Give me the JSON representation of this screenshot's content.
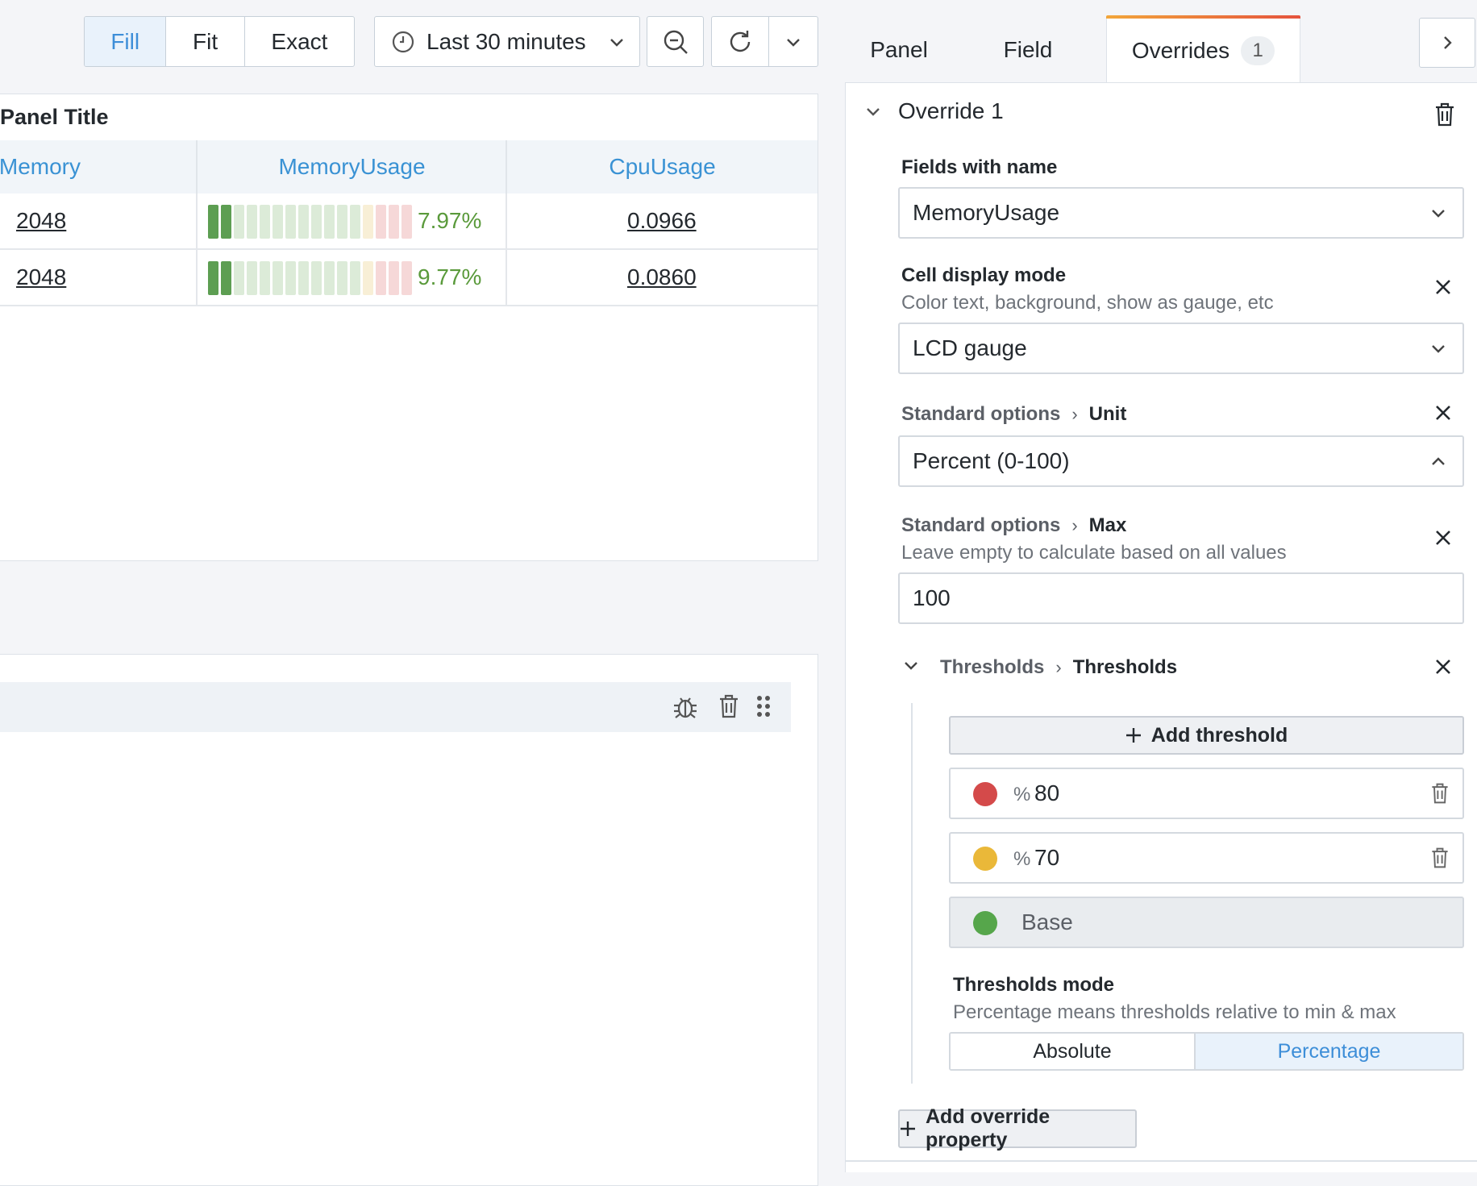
{
  "toolbar": {
    "size_modes": [
      "Fill",
      "Fit",
      "Exact"
    ],
    "active_size_mode": "Fill",
    "time_range": "Last 30 minutes"
  },
  "panel": {
    "title": "Panel Title",
    "columns": [
      "Memory",
      "MemoryUsage",
      "CpuUsage"
    ],
    "rows": [
      {
        "memory": "2048",
        "memory_usage": "7.97%",
        "memory_usage_value": 7.97,
        "cpu_usage": "0.0966"
      },
      {
        "memory": "2048",
        "memory_usage": "9.77%",
        "memory_usage_value": 9.77,
        "cpu_usage": "0.0860"
      }
    ]
  },
  "editor": {
    "tabs": [
      {
        "label": "Panel"
      },
      {
        "label": "Field"
      },
      {
        "label": "Overrides",
        "count": "1"
      }
    ],
    "override": {
      "title": "Override 1",
      "matcher_label": "Fields with name",
      "matcher_value": "MemoryUsage",
      "cell_display": {
        "label": "Cell display mode",
        "description": "Color text, background, show as gauge, etc",
        "value": "LCD gauge"
      },
      "unit": {
        "category": "Standard options",
        "label": "Unit",
        "value": "Percent (0-100)"
      },
      "max": {
        "category": "Standard options",
        "label": "Max",
        "description": "Leave empty to calculate based on all values",
        "value": "100"
      },
      "thresholds": {
        "category": "Thresholds",
        "label": "Thresholds",
        "add_label": "Add threshold",
        "steps": [
          {
            "unit": "%",
            "value": "80",
            "color": "#d44a4a"
          },
          {
            "unit": "%",
            "value": "70",
            "color": "#eab839"
          }
        ],
        "base": {
          "label": "Base",
          "color": "#56a64b"
        },
        "mode_label": "Thresholds mode",
        "mode_description": "Percentage means thresholds relative to min & max",
        "modes": [
          "Absolute",
          "Percentage"
        ],
        "active_mode": "Percentage"
      },
      "add_property_label": "Add override property"
    }
  }
}
